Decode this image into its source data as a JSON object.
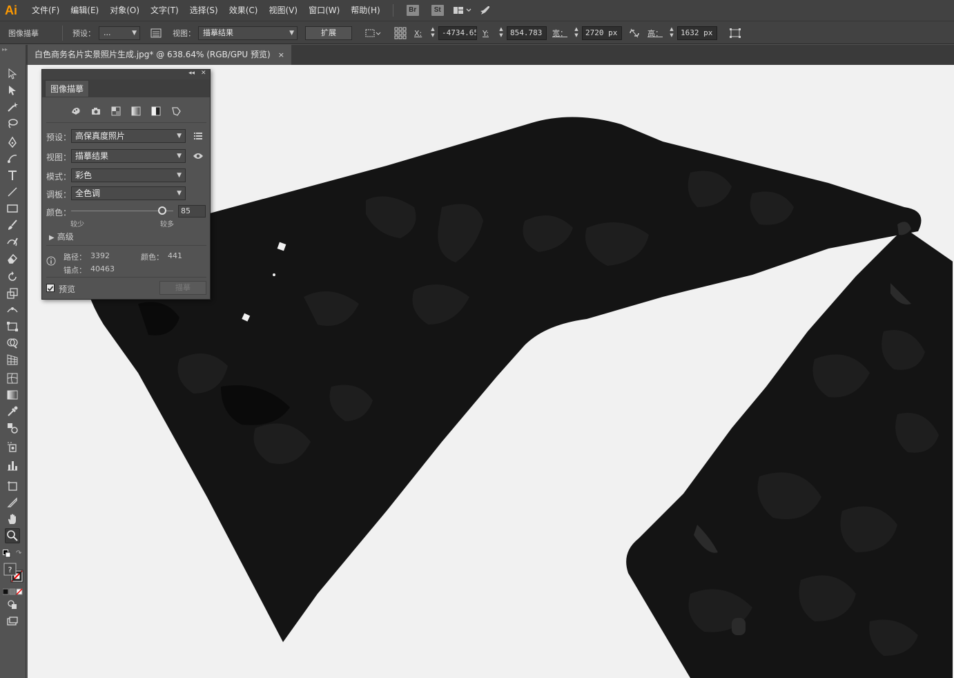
{
  "app": {
    "logo": "Ai"
  },
  "menu": [
    "文件(F)",
    "编辑(E)",
    "对象(O)",
    "文字(T)",
    "选择(S)",
    "效果(C)",
    "视图(V)",
    "窗口(W)",
    "帮助(H)"
  ],
  "badges": {
    "bridge": "Br",
    "stock": "St"
  },
  "control_bar": {
    "section_label": "图像描摹",
    "preset_label": "预设：",
    "preset_value": "...",
    "view_label": "视图：",
    "view_value": "描摹结果",
    "expand_label": "扩展",
    "x_label": "X:",
    "x_value": "-4734.655",
    "y_label": "Y:",
    "y_value": "854.783 ı",
    "w_label": "宽：",
    "w_value": "2720 px",
    "h_label": "高：",
    "h_value": "1632 px"
  },
  "document_tab": {
    "title": "白色商务名片实景照片生成.jpg* @ 638.64% (RGB/GPU 预览)",
    "close": "×"
  },
  "trace_panel": {
    "tab_title": "图像描摹",
    "preset_label": "预设：",
    "preset_value": "高保真度照片",
    "view_label": "视图：",
    "view_value": "描摹结果",
    "mode_label": "模式：",
    "mode_value": "彩色",
    "palette_label": "调板：",
    "palette_value": "全色调",
    "colors_label": "颜色：",
    "colors_value": "85",
    "colors_slider_fraction": 0.89,
    "less_label": "较少",
    "more_label": "较多",
    "advanced_label": "高级",
    "paths_label": "路径：",
    "paths_value": "3392",
    "color_count_label": "颜色：",
    "color_count_value": "441",
    "anchors_label": "锚点：",
    "anchors_value": "40463",
    "preview_label": "预览",
    "preview_checked": true,
    "trace_button": "描摹"
  },
  "colors": {
    "accent": "#ff9a00",
    "ui_dark": "#424242",
    "ui_mid": "#535353",
    "canvas": "#f1f1f1",
    "artwork": "#141414"
  }
}
